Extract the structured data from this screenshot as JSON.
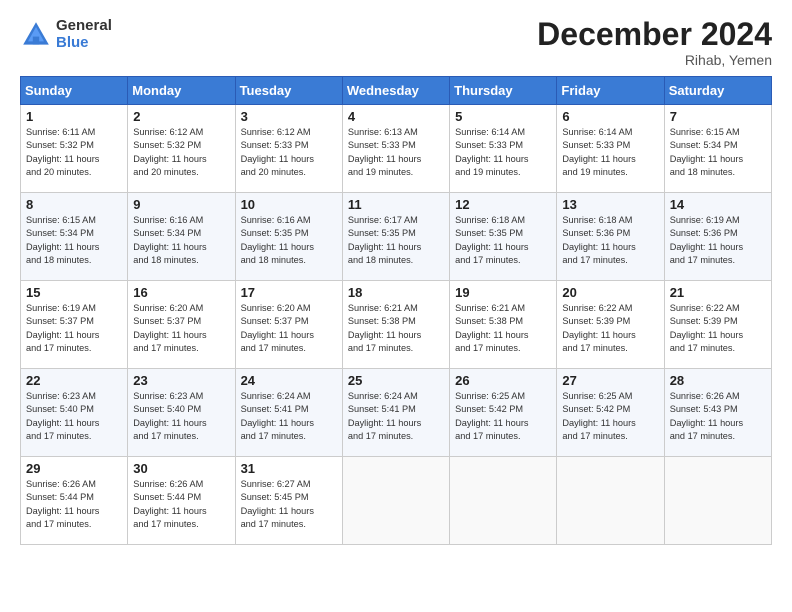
{
  "logo": {
    "general": "General",
    "blue": "Blue"
  },
  "title": "December 2024",
  "location": "Rihab, Yemen",
  "days_of_week": [
    "Sunday",
    "Monday",
    "Tuesday",
    "Wednesday",
    "Thursday",
    "Friday",
    "Saturday"
  ],
  "weeks": [
    [
      {
        "day": "1",
        "text": "Sunrise: 6:11 AM\nSunset: 5:32 PM\nDaylight: 11 hours\nand 20 minutes."
      },
      {
        "day": "2",
        "text": "Sunrise: 6:12 AM\nSunset: 5:32 PM\nDaylight: 11 hours\nand 20 minutes."
      },
      {
        "day": "3",
        "text": "Sunrise: 6:12 AM\nSunset: 5:33 PM\nDaylight: 11 hours\nand 20 minutes."
      },
      {
        "day": "4",
        "text": "Sunrise: 6:13 AM\nSunset: 5:33 PM\nDaylight: 11 hours\nand 19 minutes."
      },
      {
        "day": "5",
        "text": "Sunrise: 6:14 AM\nSunset: 5:33 PM\nDaylight: 11 hours\nand 19 minutes."
      },
      {
        "day": "6",
        "text": "Sunrise: 6:14 AM\nSunset: 5:33 PM\nDaylight: 11 hours\nand 19 minutes."
      },
      {
        "day": "7",
        "text": "Sunrise: 6:15 AM\nSunset: 5:34 PM\nDaylight: 11 hours\nand 18 minutes."
      }
    ],
    [
      {
        "day": "8",
        "text": "Sunrise: 6:15 AM\nSunset: 5:34 PM\nDaylight: 11 hours\nand 18 minutes."
      },
      {
        "day": "9",
        "text": "Sunrise: 6:16 AM\nSunset: 5:34 PM\nDaylight: 11 hours\nand 18 minutes."
      },
      {
        "day": "10",
        "text": "Sunrise: 6:16 AM\nSunset: 5:35 PM\nDaylight: 11 hours\nand 18 minutes."
      },
      {
        "day": "11",
        "text": "Sunrise: 6:17 AM\nSunset: 5:35 PM\nDaylight: 11 hours\nand 18 minutes."
      },
      {
        "day": "12",
        "text": "Sunrise: 6:18 AM\nSunset: 5:35 PM\nDaylight: 11 hours\nand 17 minutes."
      },
      {
        "day": "13",
        "text": "Sunrise: 6:18 AM\nSunset: 5:36 PM\nDaylight: 11 hours\nand 17 minutes."
      },
      {
        "day": "14",
        "text": "Sunrise: 6:19 AM\nSunset: 5:36 PM\nDaylight: 11 hours\nand 17 minutes."
      }
    ],
    [
      {
        "day": "15",
        "text": "Sunrise: 6:19 AM\nSunset: 5:37 PM\nDaylight: 11 hours\nand 17 minutes."
      },
      {
        "day": "16",
        "text": "Sunrise: 6:20 AM\nSunset: 5:37 PM\nDaylight: 11 hours\nand 17 minutes."
      },
      {
        "day": "17",
        "text": "Sunrise: 6:20 AM\nSunset: 5:37 PM\nDaylight: 11 hours\nand 17 minutes."
      },
      {
        "day": "18",
        "text": "Sunrise: 6:21 AM\nSunset: 5:38 PM\nDaylight: 11 hours\nand 17 minutes."
      },
      {
        "day": "19",
        "text": "Sunrise: 6:21 AM\nSunset: 5:38 PM\nDaylight: 11 hours\nand 17 minutes."
      },
      {
        "day": "20",
        "text": "Sunrise: 6:22 AM\nSunset: 5:39 PM\nDaylight: 11 hours\nand 17 minutes."
      },
      {
        "day": "21",
        "text": "Sunrise: 6:22 AM\nSunset: 5:39 PM\nDaylight: 11 hours\nand 17 minutes."
      }
    ],
    [
      {
        "day": "22",
        "text": "Sunrise: 6:23 AM\nSunset: 5:40 PM\nDaylight: 11 hours\nand 17 minutes."
      },
      {
        "day": "23",
        "text": "Sunrise: 6:23 AM\nSunset: 5:40 PM\nDaylight: 11 hours\nand 17 minutes."
      },
      {
        "day": "24",
        "text": "Sunrise: 6:24 AM\nSunset: 5:41 PM\nDaylight: 11 hours\nand 17 minutes."
      },
      {
        "day": "25",
        "text": "Sunrise: 6:24 AM\nSunset: 5:41 PM\nDaylight: 11 hours\nand 17 minutes."
      },
      {
        "day": "26",
        "text": "Sunrise: 6:25 AM\nSunset: 5:42 PM\nDaylight: 11 hours\nand 17 minutes."
      },
      {
        "day": "27",
        "text": "Sunrise: 6:25 AM\nSunset: 5:42 PM\nDaylight: 11 hours\nand 17 minutes."
      },
      {
        "day": "28",
        "text": "Sunrise: 6:26 AM\nSunset: 5:43 PM\nDaylight: 11 hours\nand 17 minutes."
      }
    ],
    [
      {
        "day": "29",
        "text": "Sunrise: 6:26 AM\nSunset: 5:44 PM\nDaylight: 11 hours\nand 17 minutes."
      },
      {
        "day": "30",
        "text": "Sunrise: 6:26 AM\nSunset: 5:44 PM\nDaylight: 11 hours\nand 17 minutes."
      },
      {
        "day": "31",
        "text": "Sunrise: 6:27 AM\nSunset: 5:45 PM\nDaylight: 11 hours\nand 17 minutes."
      },
      {
        "day": "",
        "text": ""
      },
      {
        "day": "",
        "text": ""
      },
      {
        "day": "",
        "text": ""
      },
      {
        "day": "",
        "text": ""
      }
    ]
  ]
}
